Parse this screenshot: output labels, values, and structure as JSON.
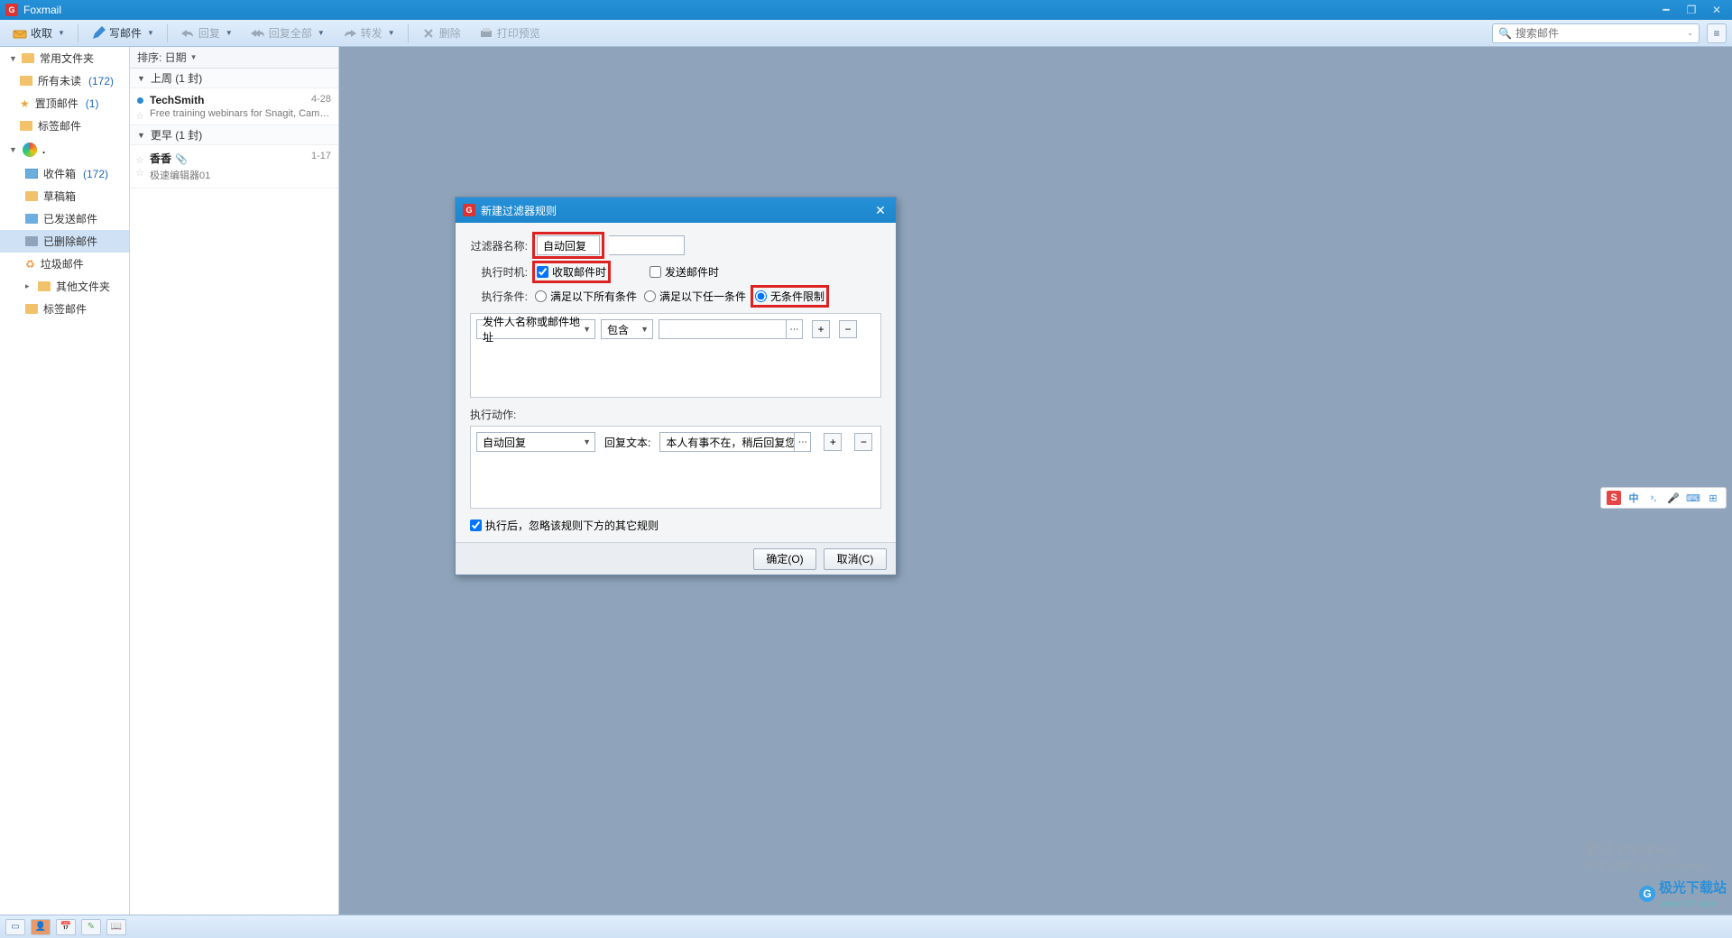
{
  "app": {
    "title": "Foxmail"
  },
  "toolbar": {
    "receive": "收取",
    "compose": "写邮件",
    "reply": "回复",
    "reply_all": "回复全部",
    "forward": "转发",
    "delete": "删除",
    "print_preview": "打印预览",
    "search_placeholder": "搜索邮件"
  },
  "sidebar": {
    "common": "常用文件夹",
    "all_unread": "所有未读",
    "all_unread_count": "(172)",
    "pinned": "置顶邮件",
    "pinned_count": "(1)",
    "tagged": "标签邮件",
    "account_dot": ".",
    "inbox": "收件箱",
    "inbox_count": "(172)",
    "drafts": "草稿箱",
    "sent": "已发送邮件",
    "deleted": "已删除邮件",
    "junk": "垃圾邮件",
    "other": "其他文件夹",
    "tags": "标签邮件"
  },
  "maillist": {
    "sort_label": "排序: 日期",
    "groups": [
      {
        "title": "上周 (1 封)",
        "items": [
          {
            "sender": "TechSmith",
            "date": "4-28",
            "subject": "Free training webinars for Snagit, Camtasia...",
            "unread": true
          }
        ]
      },
      {
        "title": "更早 (1 封)",
        "items": [
          {
            "sender": "香香",
            "date": "1-17",
            "subject": "极速编辑器01",
            "attachment": true
          }
        ]
      }
    ]
  },
  "dialog": {
    "title": "新建过滤器规则",
    "name_label": "过滤器名称:",
    "name_value": "自动回复",
    "timing_label": "执行时机:",
    "on_receive": "收取邮件时",
    "on_send": "发送邮件时",
    "cond_label": "执行条件:",
    "cond_all": "满足以下所有条件",
    "cond_any": "满足以下任一条件",
    "cond_none": "无条件限制",
    "cond_field": "发件人名称或邮件地址",
    "cond_op": "包含",
    "action_label": "执行动作:",
    "action_type": "自动回复",
    "reply_label": "回复文本:",
    "reply_text": "本人有事不在，稍后回复您",
    "skip_rest": "执行后，忽略该规则下方的其它规则",
    "ok": "确定(O)",
    "cancel": "取消(C)"
  },
  "ime": {
    "items": [
      "中",
      "›,",
      "🎤",
      "⌨",
      "⊞"
    ]
  },
  "watermark": {
    "t1": "激活 Windows",
    "t2": "转到\"设置\"以激活 Windows。",
    "site_name": "极光下载站",
    "site_url": "www.xz7.com"
  }
}
